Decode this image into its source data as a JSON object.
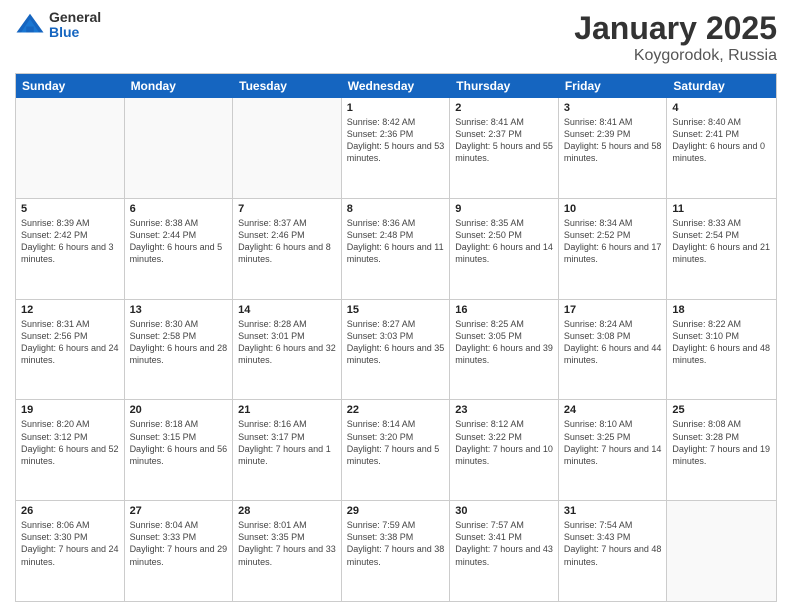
{
  "logo": {
    "general": "General",
    "blue": "Blue"
  },
  "title": "January 2025",
  "subtitle": "Koygorodok, Russia",
  "header_days": [
    "Sunday",
    "Monday",
    "Tuesday",
    "Wednesday",
    "Thursday",
    "Friday",
    "Saturday"
  ],
  "weeks": [
    [
      {
        "day": "",
        "info": "",
        "empty": true
      },
      {
        "day": "",
        "info": "",
        "empty": true
      },
      {
        "day": "",
        "info": "",
        "empty": true
      },
      {
        "day": "1",
        "info": "Sunrise: 8:42 AM\nSunset: 2:36 PM\nDaylight: 5 hours\nand 53 minutes."
      },
      {
        "day": "2",
        "info": "Sunrise: 8:41 AM\nSunset: 2:37 PM\nDaylight: 5 hours\nand 55 minutes."
      },
      {
        "day": "3",
        "info": "Sunrise: 8:41 AM\nSunset: 2:39 PM\nDaylight: 5 hours\nand 58 minutes."
      },
      {
        "day": "4",
        "info": "Sunrise: 8:40 AM\nSunset: 2:41 PM\nDaylight: 6 hours\nand 0 minutes."
      }
    ],
    [
      {
        "day": "5",
        "info": "Sunrise: 8:39 AM\nSunset: 2:42 PM\nDaylight: 6 hours\nand 3 minutes."
      },
      {
        "day": "6",
        "info": "Sunrise: 8:38 AM\nSunset: 2:44 PM\nDaylight: 6 hours\nand 5 minutes."
      },
      {
        "day": "7",
        "info": "Sunrise: 8:37 AM\nSunset: 2:46 PM\nDaylight: 6 hours\nand 8 minutes."
      },
      {
        "day": "8",
        "info": "Sunrise: 8:36 AM\nSunset: 2:48 PM\nDaylight: 6 hours\nand 11 minutes."
      },
      {
        "day": "9",
        "info": "Sunrise: 8:35 AM\nSunset: 2:50 PM\nDaylight: 6 hours\nand 14 minutes."
      },
      {
        "day": "10",
        "info": "Sunrise: 8:34 AM\nSunset: 2:52 PM\nDaylight: 6 hours\nand 17 minutes."
      },
      {
        "day": "11",
        "info": "Sunrise: 8:33 AM\nSunset: 2:54 PM\nDaylight: 6 hours\nand 21 minutes."
      }
    ],
    [
      {
        "day": "12",
        "info": "Sunrise: 8:31 AM\nSunset: 2:56 PM\nDaylight: 6 hours\nand 24 minutes."
      },
      {
        "day": "13",
        "info": "Sunrise: 8:30 AM\nSunset: 2:58 PM\nDaylight: 6 hours\nand 28 minutes."
      },
      {
        "day": "14",
        "info": "Sunrise: 8:28 AM\nSunset: 3:01 PM\nDaylight: 6 hours\nand 32 minutes."
      },
      {
        "day": "15",
        "info": "Sunrise: 8:27 AM\nSunset: 3:03 PM\nDaylight: 6 hours\nand 35 minutes."
      },
      {
        "day": "16",
        "info": "Sunrise: 8:25 AM\nSunset: 3:05 PM\nDaylight: 6 hours\nand 39 minutes."
      },
      {
        "day": "17",
        "info": "Sunrise: 8:24 AM\nSunset: 3:08 PM\nDaylight: 6 hours\nand 44 minutes."
      },
      {
        "day": "18",
        "info": "Sunrise: 8:22 AM\nSunset: 3:10 PM\nDaylight: 6 hours\nand 48 minutes."
      }
    ],
    [
      {
        "day": "19",
        "info": "Sunrise: 8:20 AM\nSunset: 3:12 PM\nDaylight: 6 hours\nand 52 minutes."
      },
      {
        "day": "20",
        "info": "Sunrise: 8:18 AM\nSunset: 3:15 PM\nDaylight: 6 hours\nand 56 minutes."
      },
      {
        "day": "21",
        "info": "Sunrise: 8:16 AM\nSunset: 3:17 PM\nDaylight: 7 hours\nand 1 minute."
      },
      {
        "day": "22",
        "info": "Sunrise: 8:14 AM\nSunset: 3:20 PM\nDaylight: 7 hours\nand 5 minutes."
      },
      {
        "day": "23",
        "info": "Sunrise: 8:12 AM\nSunset: 3:22 PM\nDaylight: 7 hours\nand 10 minutes."
      },
      {
        "day": "24",
        "info": "Sunrise: 8:10 AM\nSunset: 3:25 PM\nDaylight: 7 hours\nand 14 minutes."
      },
      {
        "day": "25",
        "info": "Sunrise: 8:08 AM\nSunset: 3:28 PM\nDaylight: 7 hours\nand 19 minutes."
      }
    ],
    [
      {
        "day": "26",
        "info": "Sunrise: 8:06 AM\nSunset: 3:30 PM\nDaylight: 7 hours\nand 24 minutes."
      },
      {
        "day": "27",
        "info": "Sunrise: 8:04 AM\nSunset: 3:33 PM\nDaylight: 7 hours\nand 29 minutes."
      },
      {
        "day": "28",
        "info": "Sunrise: 8:01 AM\nSunset: 3:35 PM\nDaylight: 7 hours\nand 33 minutes."
      },
      {
        "day": "29",
        "info": "Sunrise: 7:59 AM\nSunset: 3:38 PM\nDaylight: 7 hours\nand 38 minutes."
      },
      {
        "day": "30",
        "info": "Sunrise: 7:57 AM\nSunset: 3:41 PM\nDaylight: 7 hours\nand 43 minutes."
      },
      {
        "day": "31",
        "info": "Sunrise: 7:54 AM\nSunset: 3:43 PM\nDaylight: 7 hours\nand 48 minutes."
      },
      {
        "day": "",
        "info": "",
        "empty": true
      }
    ]
  ]
}
